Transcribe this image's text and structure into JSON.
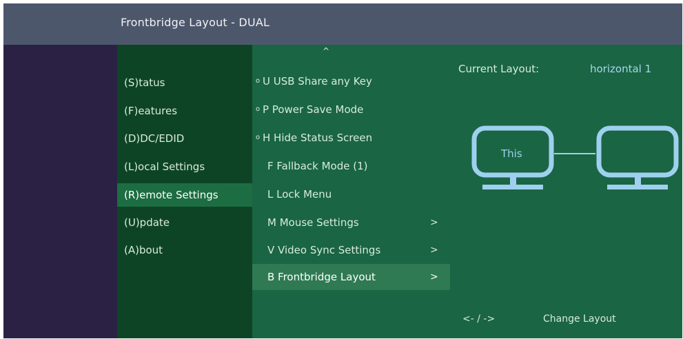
{
  "title": "Frontbridge Layout - DUAL",
  "main_menu": {
    "items": [
      {
        "label": "(S)tatus"
      },
      {
        "label": "(F)eatures"
      },
      {
        "label": "(D)DC/EDID"
      },
      {
        "label": "(L)ocal Settings"
      },
      {
        "label": "(R)emote Settings"
      },
      {
        "label": "(U)pdate"
      },
      {
        "label": "(A)bout"
      }
    ],
    "active_index": 4
  },
  "sub_menu": {
    "scroll_indicator": "^",
    "items": [
      {
        "mark": "o",
        "label": "U USB Share any Key",
        "chevron": ""
      },
      {
        "mark": "o",
        "label": "P Power Save Mode",
        "chevron": ""
      },
      {
        "mark": "o",
        "label": "H Hide Status Screen",
        "chevron": ""
      },
      {
        "mark": "",
        "label": "F Fallback Mode (1)",
        "chevron": ""
      },
      {
        "mark": "",
        "label": "L Lock Menu",
        "chevron": ""
      },
      {
        "mark": "",
        "label": "M Mouse Settings",
        "chevron": ">"
      },
      {
        "mark": "",
        "label": "V Video Sync Settings",
        "chevron": ">"
      },
      {
        "mark": "",
        "label": "B Frontbridge Layout",
        "chevron": ">"
      }
    ],
    "active_index": 7
  },
  "layout_panel": {
    "current_layout_label": "Current Layout:",
    "current_layout_value": "horizontal 1",
    "monitors": [
      {
        "label": "This"
      },
      {
        "label": ""
      }
    ],
    "change_keys": "<- / ->",
    "change_label": "Change Layout",
    "monitor_color": "#9fd0ef"
  },
  "colors": {
    "titlebar": "#4c576c",
    "background": "#2a2145",
    "main_menu": "#0e4426",
    "main_menu_active": "#1d6d42",
    "panel": "#1a6543",
    "sub_active": "#2f7a53"
  }
}
